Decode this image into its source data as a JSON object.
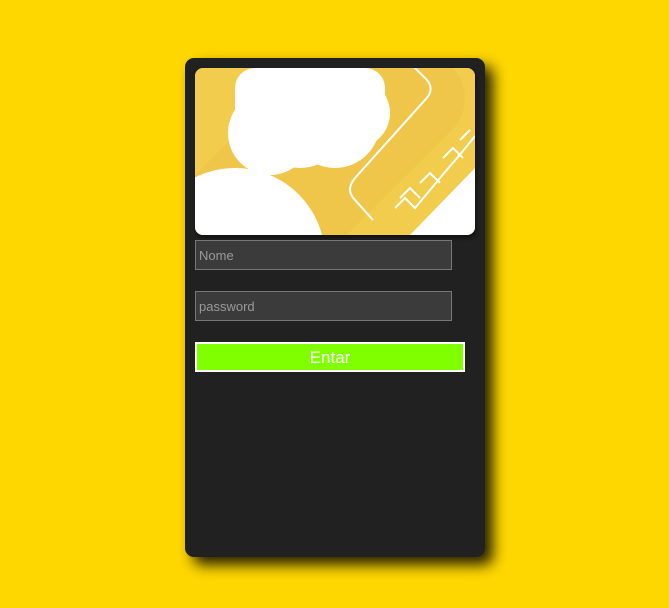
{
  "colors": {
    "page_background": "#FFD700",
    "card_background": "#212121",
    "illustration_background": "#F2CC4D",
    "button_background": "#7FFF00"
  },
  "login": {
    "name_placeholder": "Nome",
    "password_placeholder": "password",
    "submit_label": "Entar"
  }
}
